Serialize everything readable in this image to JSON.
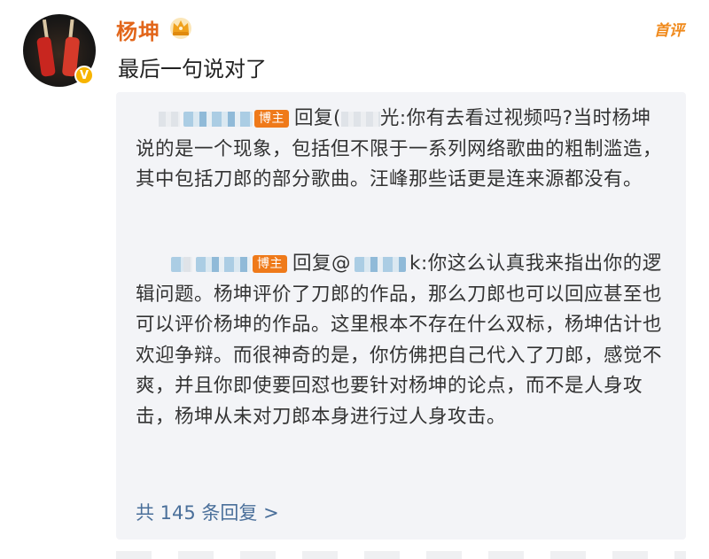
{
  "user": {
    "name": "杨坤",
    "verified_badge": "V"
  },
  "header": {
    "first_comment_label": "首评"
  },
  "comment": {
    "text": "最后一句说对了"
  },
  "replies": [
    {
      "author_badge": "博主",
      "reply_word": "回复",
      "target_prefix": "(",
      "target_suffix": "光",
      "question": ":你有去看过视频吗?",
      "body": "当时杨坤说的是一个现象，包括但不限于一系列网络歌曲的粗制滥造，其中包括刀郎的部分歌曲。汪峰那些话更是连来源都没有。"
    },
    {
      "author_badge": "博主",
      "reply_word": "回复",
      "target_prefix": "@",
      "target_suffix": "k",
      "question": ":你这么认真我来指",
      "body": "出你的逻辑问题。杨坤评价了刀郎的作品，那么刀郎也可以回应甚至也可以评价杨坤的作品。这里根本不存在什么双标，杨坤估计也欢迎争辩。而很神奇的是，你仿佛把自己代入了刀郎，感觉不爽，并且你即使要回怼也要针对杨坤的论点，而不是人身攻击，杨坤从未对刀郎本身进行过人身攻击。"
    }
  ],
  "footer": {
    "more_replies": "共 145 条回复 >"
  },
  "colors": {
    "username": "#e2661b",
    "badge": "#ef7a1a",
    "link": "#4a6f9a",
    "panel_bg": "#f3f4f7"
  },
  "icons": [
    "avatar",
    "crown-icon",
    "verified-icon"
  ]
}
